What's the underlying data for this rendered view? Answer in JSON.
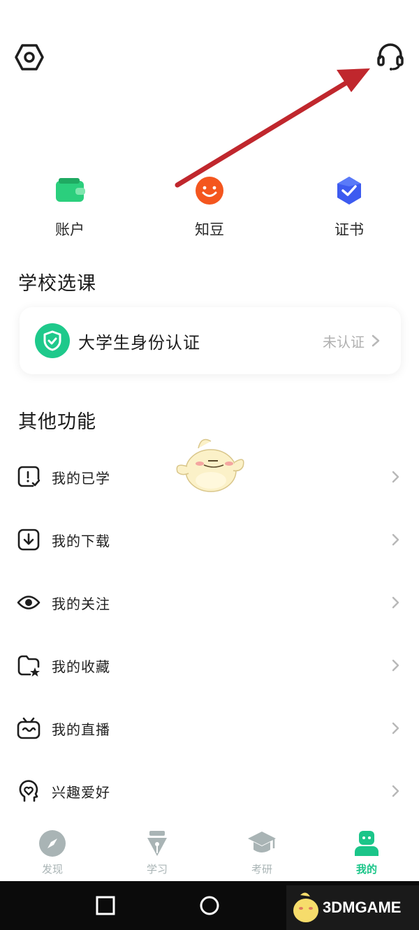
{
  "quick_actions": [
    {
      "label": "账户",
      "icon": "wallet-icon",
      "color": "#2bcf7d"
    },
    {
      "label": "知豆",
      "icon": "smiley-coin-icon",
      "color": "#f4561e"
    },
    {
      "label": "证书",
      "icon": "certificate-badge-icon",
      "color": "#3d5bf0"
    }
  ],
  "school": {
    "title": "学校选课",
    "verify_label": "大学生身份认证",
    "verify_status": "未认证"
  },
  "other": {
    "title": "其他功能",
    "items": [
      {
        "label": "我的已学",
        "icon": "learned-icon"
      },
      {
        "label": "我的下载",
        "icon": "download-icon"
      },
      {
        "label": "我的关注",
        "icon": "eye-icon"
      },
      {
        "label": "我的收藏",
        "icon": "favorite-star-icon"
      },
      {
        "label": "我的直播",
        "icon": "tv-live-icon"
      },
      {
        "label": "兴趣爱好",
        "icon": "hobby-icon"
      }
    ]
  },
  "tabs": [
    {
      "label": "发现",
      "icon": "compass-icon",
      "active": false
    },
    {
      "label": "学习",
      "icon": "pen-nib-icon",
      "active": false
    },
    {
      "label": "考研",
      "icon": "graduation-cap-icon",
      "active": false
    },
    {
      "label": "我的",
      "icon": "user-icon",
      "active": true
    }
  ],
  "watermark": "3DMGAME",
  "colors": {
    "accent": "#1bc589",
    "arrow": "#c0272d",
    "tab_inactive": "#a9b4b5"
  }
}
